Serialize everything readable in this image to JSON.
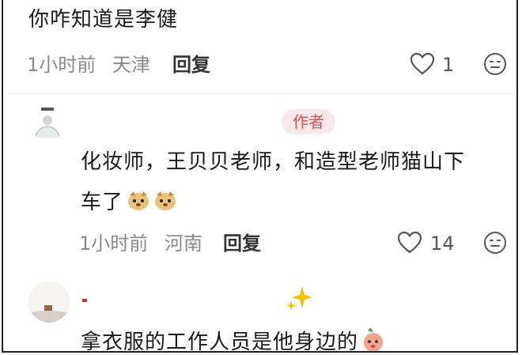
{
  "comments": [
    {
      "text": "你咋知道是李健",
      "time": "1小时前",
      "location": "天津",
      "reply_label": "回复",
      "likes": "1"
    },
    {
      "badge": "作者",
      "text_line1": "化妆师，王贝贝老师，和造型老师猫山下",
      "text_line2": "车了",
      "time": "1小时前",
      "location": "河南",
      "reply_label": "回复",
      "likes": "14"
    },
    {
      "text": "拿衣服的工作人员是他身边的"
    }
  ],
  "colors": {
    "badge_bg": "#fbe9ea",
    "badge_text": "#d9534f",
    "meta_text": "#8a8a8a"
  },
  "icons": [
    "heart-icon",
    "dislike-face-icon",
    "sparkles-icon",
    "emoji-dog-icon",
    "emoji-peach-icon"
  ]
}
